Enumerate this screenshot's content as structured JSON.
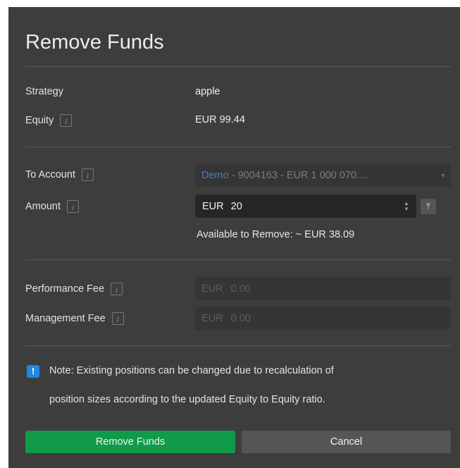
{
  "dialog": {
    "title": "Remove Funds",
    "strategy_label": "Strategy",
    "strategy_value": "apple",
    "equity_label": "Equity",
    "equity_value": "EUR 99.44",
    "to_account_label": "To Account",
    "to_account_accent": "Demo",
    "to_account_rest": " - 9004163 - EUR 1 000 070....",
    "amount_label": "Amount",
    "amount_currency": "EUR",
    "amount_value": "20",
    "available_text": "Available to Remove:  ~ EUR 38.09",
    "performance_fee_label": "Performance Fee",
    "performance_fee_currency": "EUR",
    "performance_fee_value": "0.00",
    "management_fee_label": "Management Fee",
    "management_fee_currency": "EUR",
    "management_fee_value": "0.00",
    "note_line1": "Note: Existing positions can be changed due to recalculation of",
    "note_line2": "position sizes according to the updated Equity to Equity ratio.",
    "remove_button_label": "Remove Funds",
    "cancel_button_label": "Cancel"
  },
  "icons": {
    "info": "info-icon",
    "dropdown": "chevron-down-icon",
    "stepper": "stepper-icon",
    "max": "max-icon",
    "note": "exclamation-icon"
  },
  "colors": {
    "dialog_bg": "#3d3d3d",
    "primary_button": "#0f9b49",
    "secondary_button": "#555555",
    "note_icon": "#1e88e5",
    "accent_text": "#3f7fc4"
  }
}
